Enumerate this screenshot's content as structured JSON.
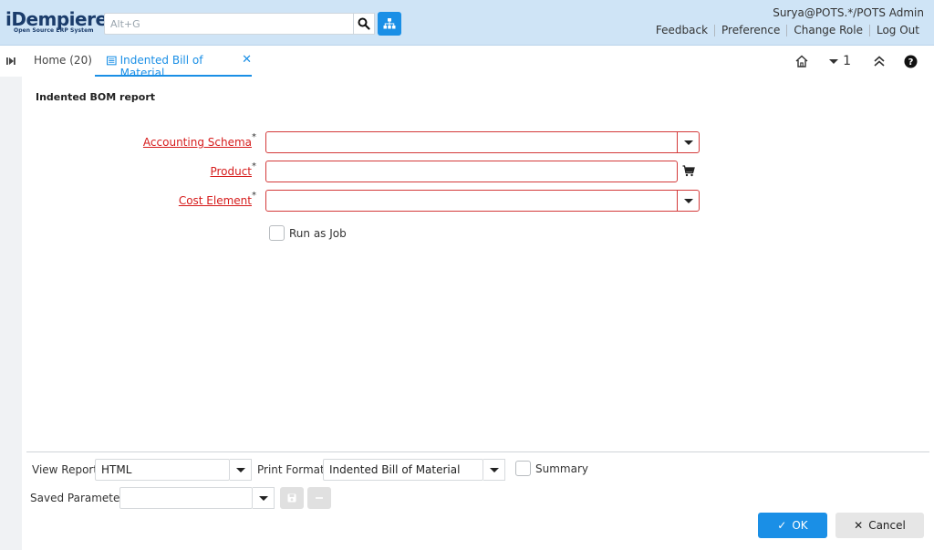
{
  "header": {
    "logo_text": "iDempiere",
    "logo_sub": "Open Source ERP System",
    "search_placeholder": "Alt+G",
    "user": "Surya@POTS.*/POTS Admin",
    "links": [
      "Feedback",
      "Preference",
      "Change Role",
      "Log Out"
    ]
  },
  "tabs": {
    "home": "Home (20)",
    "active": "Indented Bill of Material",
    "window_count": "1"
  },
  "report": {
    "title": "Indented BOM report",
    "fields": [
      {
        "label": "Accounting Schema",
        "required": "*",
        "value": "",
        "type": "dropdown"
      },
      {
        "label": "Product",
        "required": "*",
        "value": "",
        "type": "search"
      },
      {
        "label": "Cost Element",
        "required": "*",
        "value": "",
        "type": "dropdown"
      }
    ],
    "run_as_job": "Run as Job"
  },
  "bottom": {
    "view_report_label": "View Report",
    "view_report_value": "HTML",
    "print_format_label": "Print Format",
    "print_format_value": "Indented Bill of Material",
    "summary_label": "Summary",
    "saved_parameters_label": "Saved Parameters",
    "saved_parameters_value": "",
    "ok_label": "OK",
    "cancel_label": "Cancel"
  },
  "colors": {
    "header_bg": "#cfe4f6",
    "accent": "#1a8fe6",
    "required_red": "#d61c1c"
  }
}
